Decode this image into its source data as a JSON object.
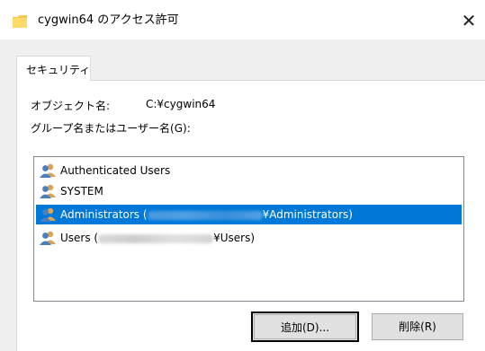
{
  "window": {
    "title": "cygwin64 のアクセス許可",
    "close_glyph": "✕"
  },
  "tabs": [
    {
      "label": "セキュリティ"
    }
  ],
  "object": {
    "label": "オブジェクト名:",
    "value": "C:¥cygwin64"
  },
  "group_list": {
    "label": "グループ名またはユーザー名(G):",
    "items": [
      {
        "prefix": "Authenticated Users",
        "suffix": "",
        "redacted": false,
        "selected": false
      },
      {
        "prefix": "SYSTEM",
        "suffix": "",
        "redacted": false,
        "selected": false
      },
      {
        "prefix": "Administrators (",
        "suffix": "¥Administrators)",
        "redacted": true,
        "selected": true
      },
      {
        "prefix": "Users (",
        "suffix": "¥Users)",
        "redacted": true,
        "selected": false
      }
    ]
  },
  "buttons": {
    "add": "追加(D)...",
    "remove": "削除(R)"
  },
  "icons": {
    "folder": "folder-icon",
    "users": "users-icon",
    "close": "close-icon"
  },
  "colors": {
    "selection": "#0078d7",
    "folder": "#f5c84c",
    "user_front": "#4a7fbf",
    "user_back": "#d9a45a"
  }
}
